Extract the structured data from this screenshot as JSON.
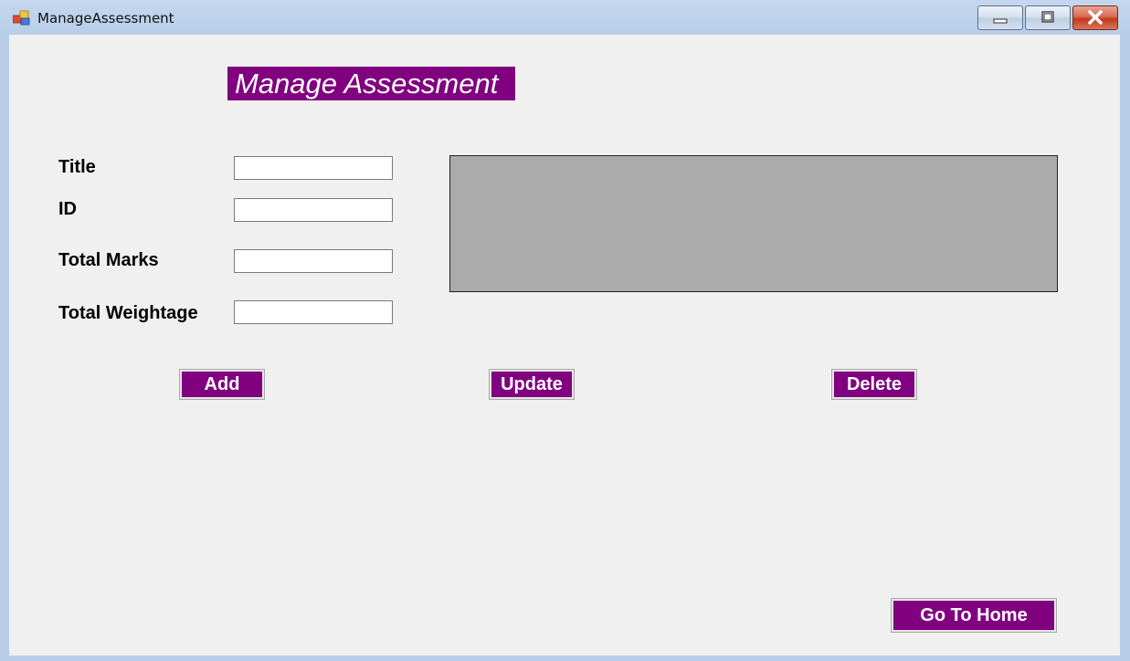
{
  "window": {
    "title": "ManageAssessment",
    "icons": {
      "app": "app-icon",
      "minimize": "minimize-icon",
      "maximize": "maximize-icon",
      "close": "close-icon"
    }
  },
  "main": {
    "heading": "Manage Assessment",
    "fields": [
      {
        "label": "Title",
        "value": ""
      },
      {
        "label": "ID",
        "value": ""
      },
      {
        "label": "Total Marks",
        "value": ""
      },
      {
        "label": "Total Weightage",
        "value": ""
      }
    ],
    "buttons": {
      "add": "Add",
      "update": "Update",
      "delete": "Delete",
      "home": "Go To Home"
    }
  },
  "colors": {
    "accent": "#800080",
    "grid_background": "#ababab",
    "form_background": "#f0f0f0"
  }
}
